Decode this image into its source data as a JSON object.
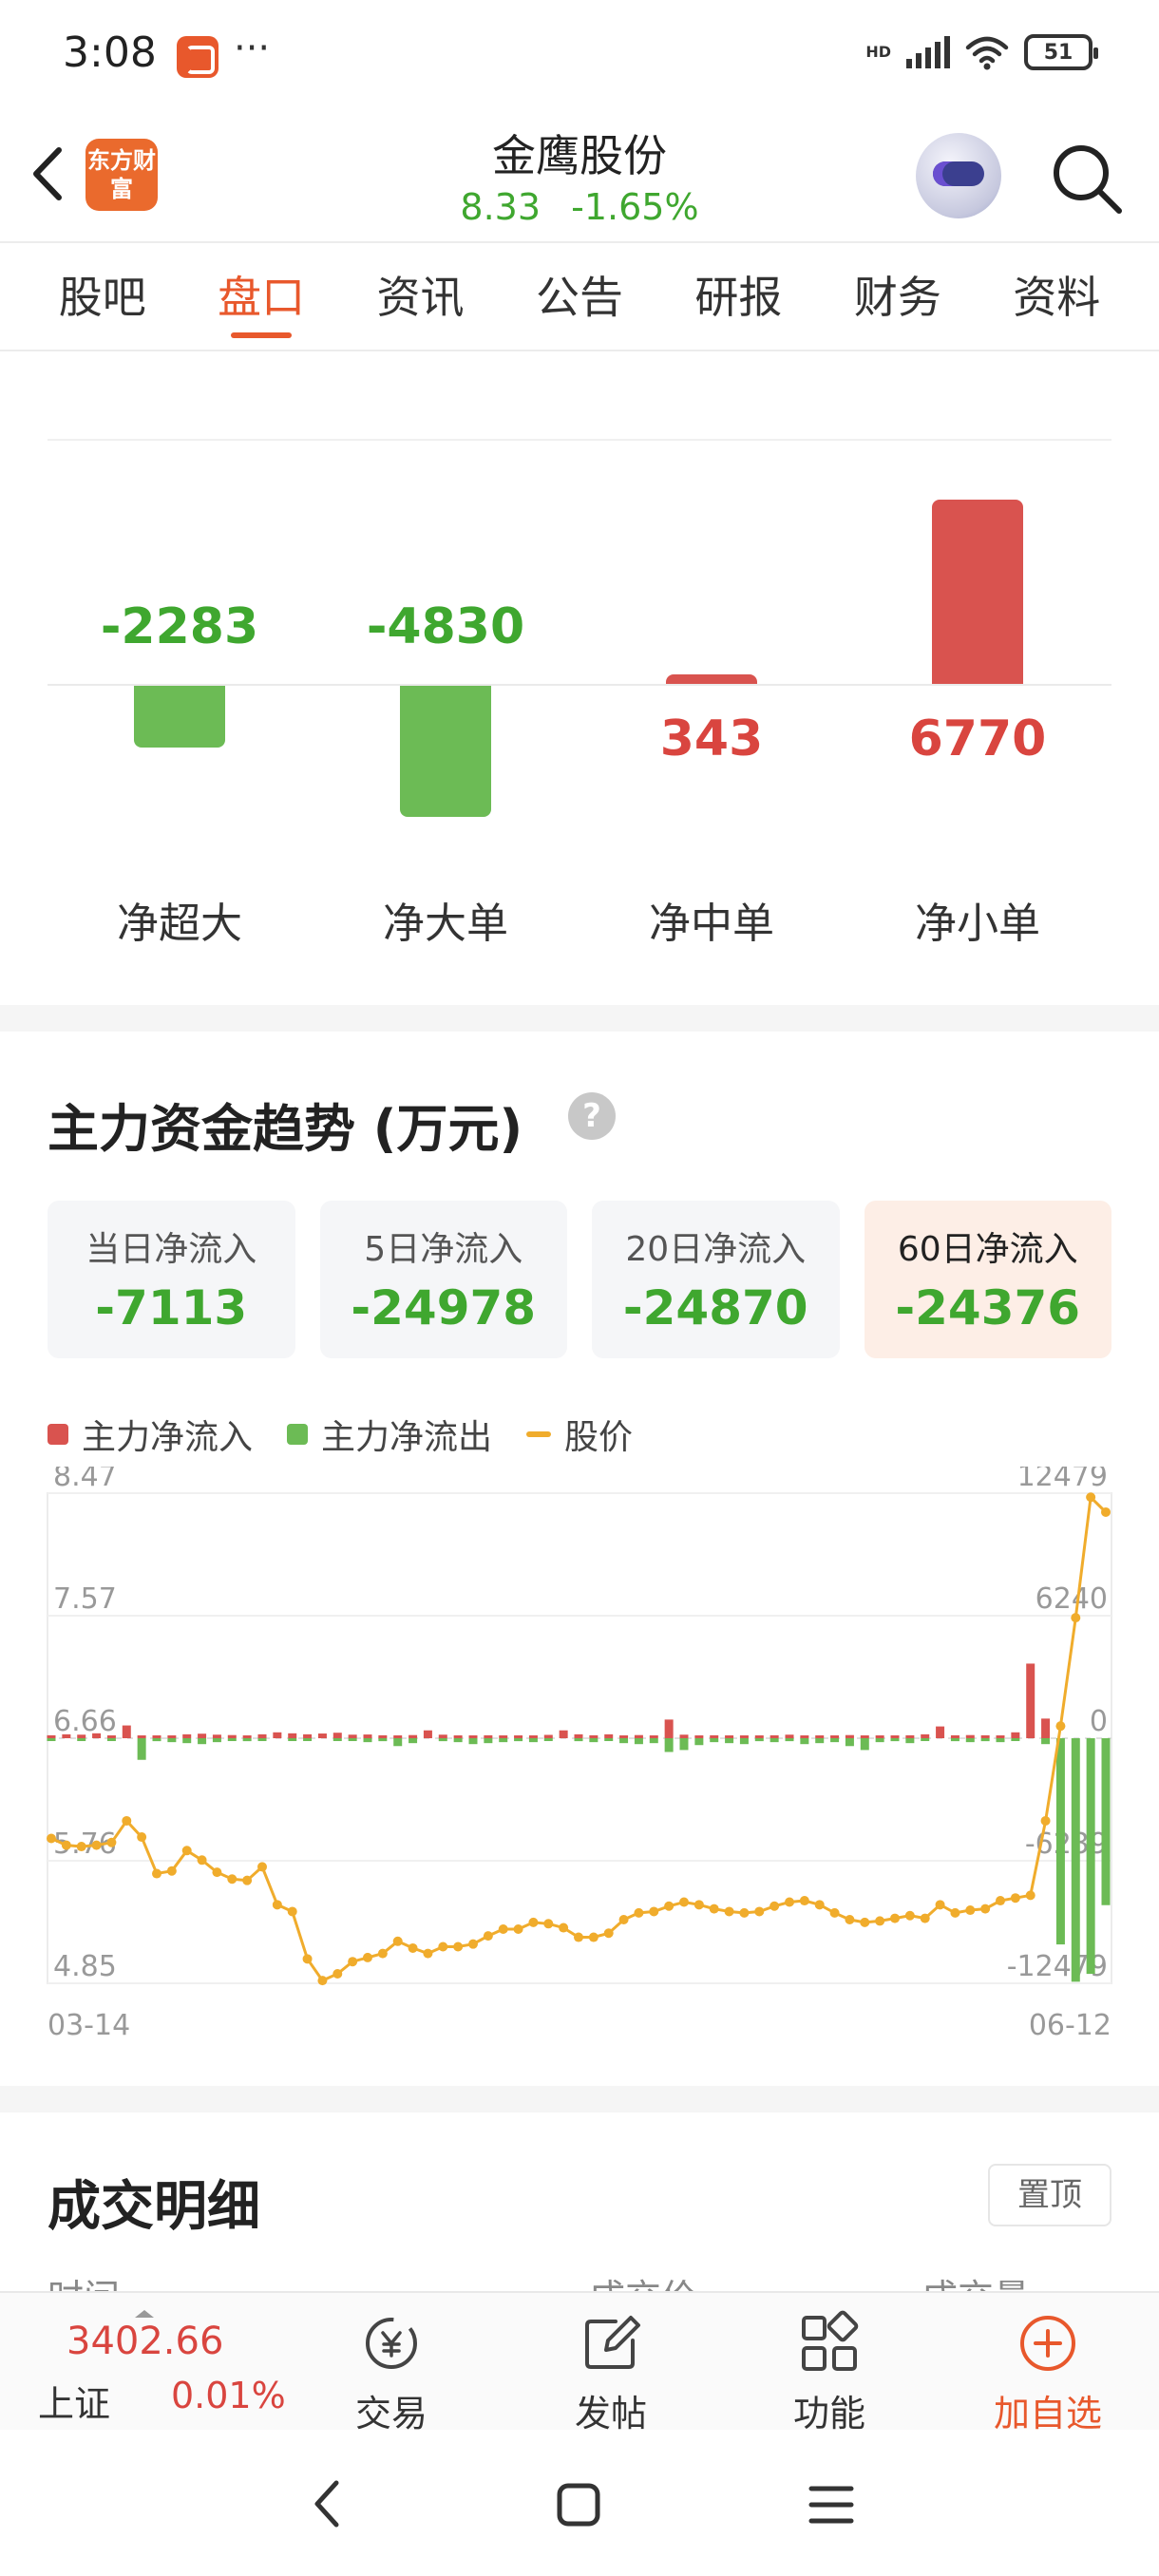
{
  "status_bar": {
    "time": "3:08",
    "more": "···",
    "network": "HD",
    "battery": "51"
  },
  "header": {
    "logo_text": "东方财富",
    "title": "金鹰股份",
    "price": "8.33",
    "change_pct": "-1.65%",
    "change_color": "#3fa72f"
  },
  "tabs": [
    {
      "label": "股吧",
      "active": false
    },
    {
      "label": "盘口",
      "active": true
    },
    {
      "label": "资讯",
      "active": false
    },
    {
      "label": "公告",
      "active": false
    },
    {
      "label": "研报",
      "active": false
    },
    {
      "label": "财务",
      "active": false
    },
    {
      "label": "资料",
      "active": false
    }
  ],
  "flow": {
    "items": [
      {
        "label": "净超大",
        "value": -2283,
        "display": "-2283"
      },
      {
        "label": "净大单",
        "value": -4830,
        "display": "-4830"
      },
      {
        "label": "净中单",
        "value": 343,
        "display": "343"
      },
      {
        "label": "净小单",
        "value": 6770,
        "display": "6770"
      }
    ],
    "colors": {
      "inflow": "#d9534f",
      "outflow": "#6cbb55"
    }
  },
  "trend": {
    "title": "主力资金趋势 (万元)",
    "help": "?",
    "cards": [
      {
        "label": "当日净流入",
        "value": "-7113",
        "active": false
      },
      {
        "label": "5日净流入",
        "value": "-24978",
        "active": false
      },
      {
        "label": "20日净流入",
        "value": "-24870",
        "active": false
      },
      {
        "label": "60日净流入",
        "value": "-24376",
        "active": true
      }
    ],
    "legend": {
      "inflow": "主力净流入",
      "outflow": "主力净流出",
      "price": "股价"
    }
  },
  "chart_data": {
    "type": "bar",
    "x_start_label": "03-14",
    "x_end_label": "06-12",
    "left_axis_ticks": [
      "8.47",
      "7.57",
      "6.66",
      "5.76",
      "4.85"
    ],
    "right_axis_ticks": [
      "12479",
      "6240",
      "0",
      "-6239",
      "-12479"
    ],
    "ylim_price": [
      4.85,
      8.47
    ],
    "ylim_flow": [
      -12479,
      12479
    ],
    "colors": {
      "inflow": "#d9534f",
      "outflow": "#6cbb55",
      "price": "#f0ac2c"
    },
    "series": [
      {
        "name": "股价",
        "values": [
          5.92,
          5.87,
          5.86,
          5.87,
          5.89,
          6.05,
          5.93,
          5.66,
          5.68,
          5.83,
          5.76,
          5.67,
          5.62,
          5.61,
          5.71,
          5.43,
          5.38,
          5.03,
          4.87,
          4.92,
          5.01,
          5.04,
          5.07,
          5.16,
          5.11,
          5.07,
          5.12,
          5.12,
          5.14,
          5.2,
          5.25,
          5.25,
          5.3,
          5.29,
          5.26,
          5.19,
          5.19,
          5.22,
          5.32,
          5.37,
          5.38,
          5.42,
          5.45,
          5.43,
          5.4,
          5.38,
          5.37,
          5.38,
          5.42,
          5.45,
          5.46,
          5.43,
          5.37,
          5.32,
          5.3,
          5.31,
          5.33,
          5.35,
          5.33,
          5.43,
          5.37,
          5.39,
          5.4,
          5.46,
          5.48,
          5.5,
          6.05,
          6.75,
          7.55,
          8.44,
          8.33
        ]
      },
      {
        "name": "主力净流入",
        "values": [
          150,
          200,
          180,
          250,
          120,
          650,
          100,
          90,
          110,
          200,
          230,
          180,
          160,
          120,
          200,
          300,
          250,
          200,
          240,
          280,
          180,
          190,
          150,
          120,
          160,
          400,
          180,
          90,
          100,
          150,
          130,
          120,
          100,
          170,
          400,
          200,
          150,
          200,
          110,
          160,
          120,
          950,
          180,
          100,
          150,
          120,
          140,
          130,
          150,
          180,
          100,
          120,
          140,
          160,
          130,
          110,
          120,
          150,
          200,
          600,
          150,
          160,
          150,
          130,
          300,
          3800,
          1000,
          0,
          0,
          0,
          0
        ]
      },
      {
        "name": "主力净流出",
        "values": [
          -100,
          0,
          -120,
          0,
          -100,
          0,
          -1100,
          -150,
          -200,
          -250,
          -300,
          -200,
          -100,
          -150,
          -120,
          0,
          -100,
          -100,
          0,
          -120,
          -100,
          -200,
          -150,
          -400,
          -250,
          0,
          -150,
          -200,
          -300,
          -250,
          -200,
          -150,
          -200,
          -100,
          0,
          -150,
          -200,
          -100,
          -250,
          -300,
          -250,
          -700,
          -600,
          -350,
          -200,
          -250,
          -300,
          -150,
          -200,
          -150,
          -300,
          -250,
          -200,
          -400,
          -600,
          -200,
          -150,
          -250,
          -100,
          0,
          -150,
          -200,
          -150,
          -200,
          -100,
          0,
          -300,
          -10500,
          -12400,
          -12000,
          -8500
        ]
      }
    ]
  },
  "deal": {
    "title": "成交明细",
    "pin": "置顶",
    "col_time": "时间",
    "col_price": "成交价",
    "col_volume": "成交量"
  },
  "bottom": {
    "index_value": "3402.66",
    "index_name": "上证",
    "index_pct": "0.01%",
    "tools": [
      {
        "label": "交易",
        "icon": "trade-icon"
      },
      {
        "label": "发帖",
        "icon": "post-icon"
      },
      {
        "label": "功能",
        "icon": "grid-icon"
      },
      {
        "label": "加自选",
        "icon": "add-circle-icon"
      }
    ]
  }
}
